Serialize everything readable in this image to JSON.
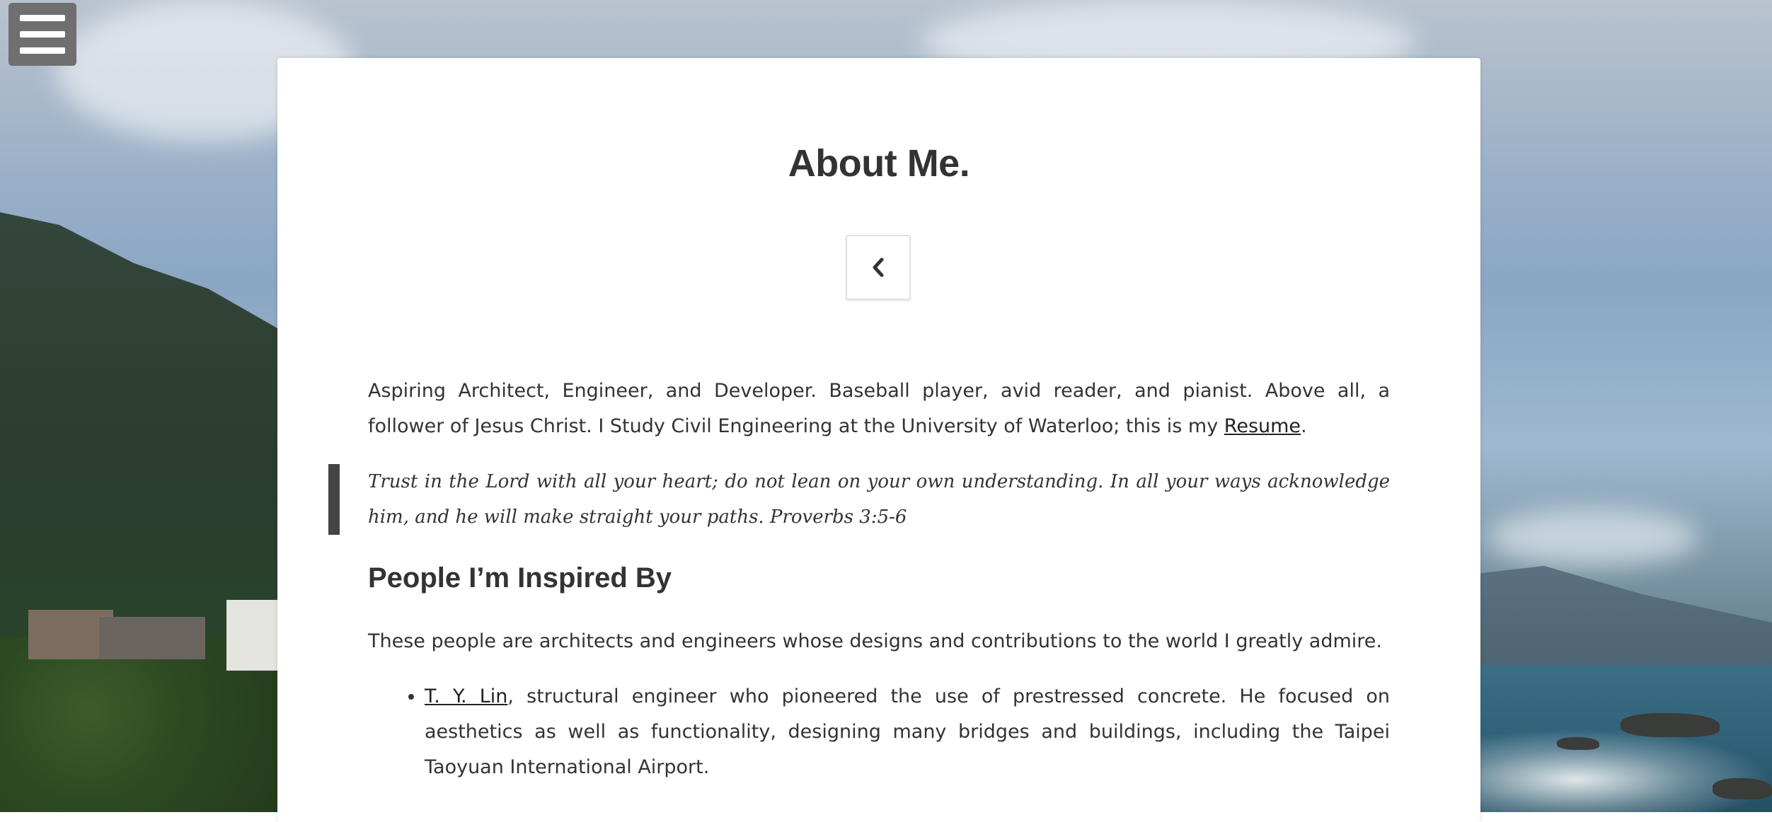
{
  "menu": {
    "icon": "hamburger-menu-icon"
  },
  "page": {
    "title": "About Me.",
    "back_icon": "chevron-left-icon"
  },
  "intro": {
    "text": "Aspiring Architect, Engineer, and Developer. Baseball player, avid reader, and pianist. Above all, a follower of Jesus Christ. I Study Civil Engineering at the University of Waterloo; this is my ",
    "resume_link": "Resume",
    "suffix": "."
  },
  "quote": {
    "text": "Trust in the Lord with all your heart; do not lean on your own understanding. In all your ways acknowledge him, and he will make straight your paths. Proverbs 3:5-6"
  },
  "inspired": {
    "heading": "People I’m Inspired By",
    "description": "These people are architects and engineers whose designs and contributions to the world I greatly admire.",
    "people": [
      {
        "name": "T. Y. Lin",
        "text": ", structural engineer who pioneered the use of prestressed concrete. He focused on aesthetics as well as functionality, designing many bridges and buildings, including the Taipei Taoyuan International Airport."
      }
    ]
  }
}
